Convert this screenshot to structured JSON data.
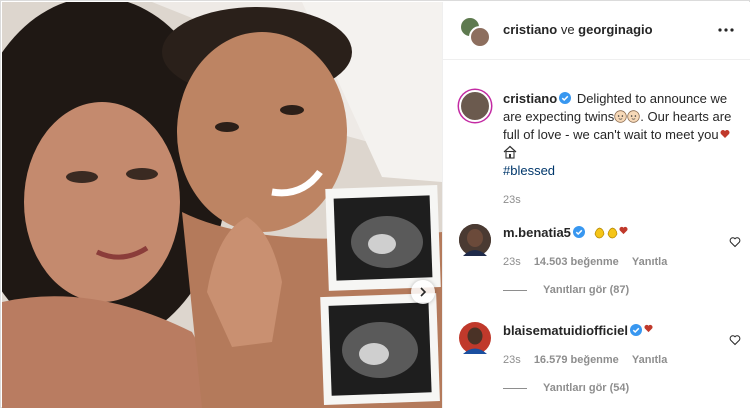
{
  "header": {
    "user1": "cristiano",
    "conjunction": "ve",
    "user2": "georginagio",
    "more_icon": "more-horizontal-icon"
  },
  "caption": {
    "username": "cristiano",
    "line1": "Delighted to announce we are expecting twins",
    "line2": ". Our hearts are full of love - we can't wait to meet you",
    "hashtag": "#blessed",
    "time": "23s",
    "emojis": [
      "baby-face-icon",
      "baby-face-icon",
      "heart-icon",
      "house-icon"
    ]
  },
  "comments": [
    {
      "username": "m.benatia5",
      "emojis": [
        "clapping-hands-icon",
        "clapping-hands-icon",
        "heart-icon"
      ],
      "time": "23s",
      "likes": "14.503 beğenme",
      "reply": "Yanıtla",
      "view_replies": "Yanıtları gör (87)"
    },
    {
      "username": "blaisematuidiofficiel",
      "emojis": [
        "heart-icon"
      ],
      "time": "23s",
      "likes": "16.579 beğenme",
      "reply": "Yanıtla",
      "view_replies": "Yanıtları gör (54)"
    }
  ],
  "colors": {
    "text": "#262626",
    "muted": "#8e8e8e",
    "link": "#00376b",
    "verified": "#3897f0",
    "heart": "#ed4956"
  }
}
